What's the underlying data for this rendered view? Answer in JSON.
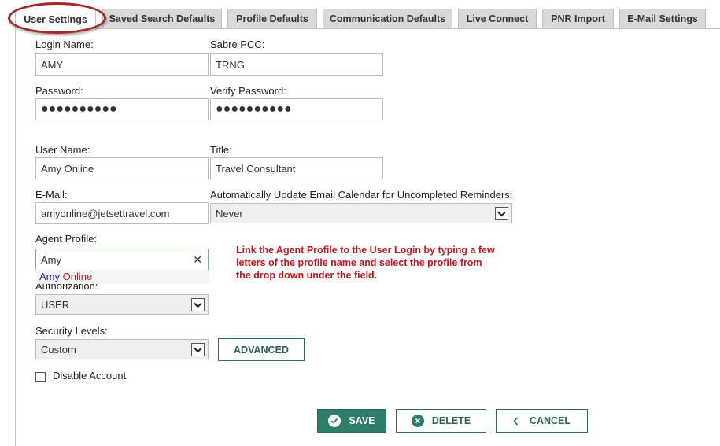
{
  "tabs": [
    {
      "label": "User Settings"
    },
    {
      "label": "Saved Search Defaults"
    },
    {
      "label": "Profile Defaults"
    },
    {
      "label": "Communication Defaults"
    },
    {
      "label": "Live Connect"
    },
    {
      "label": "PNR Import"
    },
    {
      "label": "E-Mail Settings"
    }
  ],
  "form": {
    "login_name": {
      "label": "Login Name:",
      "value": "AMY"
    },
    "sabre_pcc": {
      "label": "Sabre PCC:",
      "value": "TRNG"
    },
    "password": {
      "label": "Password:",
      "value": "●●●●●●●●●●"
    },
    "verify_password": {
      "label": "Verify Password:",
      "value": "●●●●●●●●●●"
    },
    "user_name": {
      "label": "User Name:",
      "value": "Amy Online"
    },
    "title": {
      "label": "Title:",
      "value": "Travel Consultant"
    },
    "email": {
      "label": "E-Mail:",
      "value": "amyonline@jetsettravel.com"
    },
    "auto_update": {
      "label": "Automatically Update Email Calendar for Uncompleted Reminders:",
      "value": "Never"
    },
    "agent_profile": {
      "label": "Agent Profile:",
      "value": "Amy",
      "suggestion_match": "Amy",
      "suggestion_rest": " Online"
    },
    "authorization": {
      "label": "Authorization:",
      "value": "USER"
    },
    "security_levels": {
      "label": "Security Levels:",
      "value": "Custom"
    },
    "advanced_label": "ADVANCED",
    "disable_account_label": "Disable Account"
  },
  "annotation": {
    "text": "Link the Agent Profile to the User Login by typing a few letters of the profile name and select the profile from the drop down under the field."
  },
  "actions": {
    "save": "SAVE",
    "delete": "DELETE",
    "cancel": "CANCEL"
  },
  "colors": {
    "accent": "#2e7d6b",
    "annotation": "#c0191f",
    "highlight_ring": "#a32a2a",
    "suggestion_link": "#1a1aa6"
  }
}
